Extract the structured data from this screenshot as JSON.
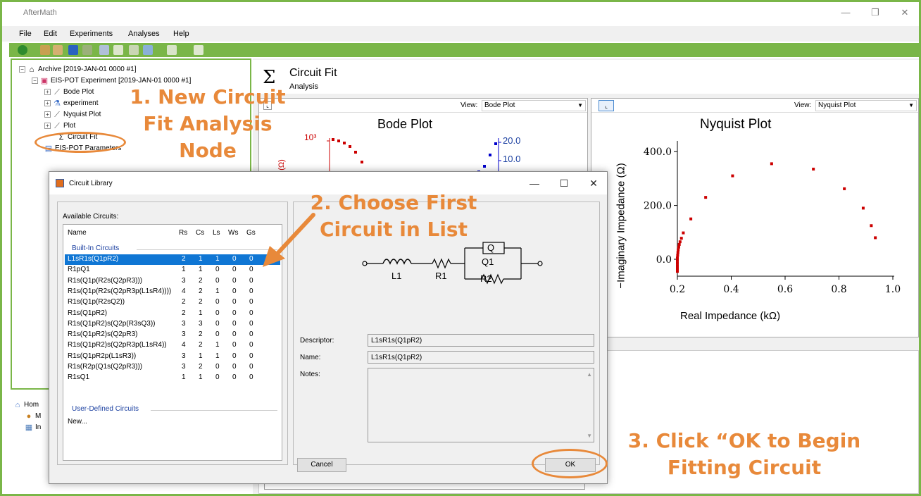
{
  "window": {
    "title": "AfterMath"
  },
  "menu": [
    "File",
    "Edit",
    "Experiments",
    "Analyses",
    "Help"
  ],
  "tree": {
    "archive": "Archive [2019-JAN-01 0000 #1]",
    "experiment": "EIS-POT Experiment [2019-JAN-01 0000 #1]",
    "children": [
      "Bode Plot",
      "experiment",
      "Nyquist Plot",
      "Plot",
      "Circuit Fit"
    ],
    "parameters": "EIS-POT Parameters",
    "home": [
      "Hom",
      "M",
      "In"
    ]
  },
  "analysis": {
    "title": "Circuit Fit",
    "subtitle": "Analysis"
  },
  "bode": {
    "view_label": "View:",
    "view_value": "Bode Plot",
    "title": "Bode Plot",
    "left_tick": "10³",
    "right_ticks": [
      "20.0",
      "10.0"
    ],
    "partial_label": "(Ω)"
  },
  "nyquist": {
    "view_label": "View:",
    "view_value": "Nyquist Plot",
    "title": "Nyquist Plot",
    "xlabel": "Real Impedance (kΩ)",
    "ylabel": "−Imaginary Impedance (Ω)",
    "xticks": [
      "0.2",
      "0.4",
      "0.6",
      "0.8",
      "1.0"
    ],
    "yticks": [
      "400.0",
      "200.0",
      "0.0"
    ]
  },
  "chart_data": {
    "type": "scatter",
    "title": "Nyquist Plot",
    "xlabel": "Real Impedance (kΩ)",
    "ylabel": "−Imaginary Impedance (Ω)",
    "xlim": [
      0.2,
      1.0
    ],
    "ylim": [
      -50,
      460
    ],
    "series": [
      {
        "x": [
          0.2,
          0.2,
          0.2,
          0.2,
          0.2,
          0.2,
          0.201,
          0.202,
          0.203,
          0.205,
          0.207,
          0.21,
          0.215,
          0.222,
          0.25,
          0.305,
          0.405,
          0.55,
          0.705,
          0.82,
          0.89,
          0.92,
          0.935
        ],
        "y": [
          -45,
          -35,
          -25,
          -15,
          -5,
          5,
          15,
          25,
          35,
          45,
          55,
          65,
          78,
          98,
          150,
          230,
          310,
          355,
          335,
          262,
          190,
          125,
          80
        ]
      }
    ],
    "color": "#cc0000"
  },
  "dialog": {
    "title": "Circuit Library",
    "available_label": "Available Circuits:",
    "columns": [
      "Name",
      "Rs",
      "Cs",
      "Ls",
      "Ws",
      "Gs"
    ],
    "builtin_label": "Built-In Circuits",
    "userdef_label": "User-Defined Circuits",
    "new_label": "New...",
    "rows": [
      [
        "L1sR1s(Q1pR2)",
        "2",
        "1",
        "1",
        "0",
        "0"
      ],
      [
        "R1pQ1",
        "1",
        "1",
        "0",
        "0",
        "0"
      ],
      [
        "R1s(Q1p(R2s(Q2pR3)))",
        "3",
        "2",
        "0",
        "0",
        "0"
      ],
      [
        "R1s(Q1p(R2s(Q2pR3p(L1sR4))))",
        "4",
        "2",
        "1",
        "0",
        "0"
      ],
      [
        "R1s(Q1p(R2sQ2))",
        "2",
        "2",
        "0",
        "0",
        "0"
      ],
      [
        "R1s(Q1pR2)",
        "2",
        "1",
        "0",
        "0",
        "0"
      ],
      [
        "R1s(Q1pR2)s(Q2p(R3sQ3))",
        "3",
        "3",
        "0",
        "0",
        "0"
      ],
      [
        "R1s(Q1pR2)s(Q2pR3)",
        "3",
        "2",
        "0",
        "0",
        "0"
      ],
      [
        "R1s(Q1pR2)s(Q2pR3p(L1sR4))",
        "4",
        "2",
        "1",
        "0",
        "0"
      ],
      [
        "R1s(Q1pR2p(L1sR3))",
        "3",
        "1",
        "1",
        "0",
        "0"
      ],
      [
        "R1s(R2p(Q1s(Q2pR3)))",
        "3",
        "2",
        "0",
        "0",
        "0"
      ],
      [
        "R1sQ1",
        "1",
        "1",
        "0",
        "0",
        "0"
      ]
    ],
    "circuit_labels": {
      "l1": "L1",
      "r1": "R1",
      "q_box": "Q",
      "q1": "Q1",
      "r2": "R2"
    },
    "descriptor_label": "Descriptor:",
    "descriptor_value": "L1sR1s(Q1pR2)",
    "name_label": "Name:",
    "name_value": "L1sR1s(Q1pR2)",
    "notes_label": "Notes:",
    "cancel": "Cancel",
    "ok": "OK"
  },
  "annotations": {
    "step1": [
      "1. New Circuit",
      "Fit Analysis",
      "Node"
    ],
    "step2": [
      "2. Choose First",
      "Circuit in List"
    ],
    "step3": [
      "3. Click “OK to Begin",
      "Fitting Circuit"
    ],
    "color": "#e8893a"
  }
}
